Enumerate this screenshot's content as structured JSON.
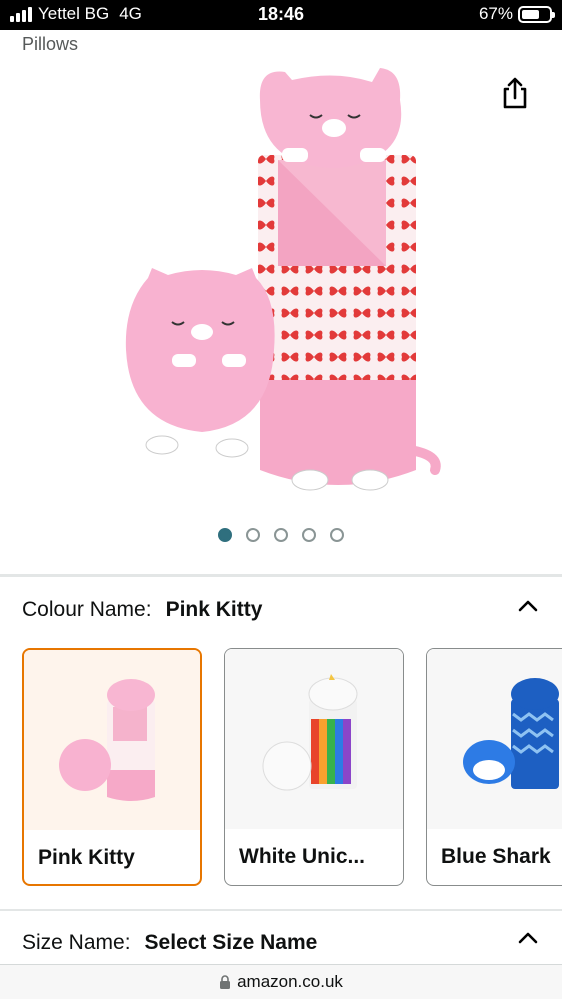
{
  "status_bar": {
    "carrier": "Yettel BG",
    "network": "4G",
    "time": "18:46",
    "battery": "67%",
    "battery_level": 0.67
  },
  "category": "Pillows",
  "carousel": {
    "total": 5,
    "active": 1
  },
  "colour": {
    "label": "Colour Name:",
    "value": "Pink Kitty",
    "options": [
      {
        "name": "Pink Kitty",
        "selected": true
      },
      {
        "name": "White Unic...",
        "selected": false
      },
      {
        "name": "Blue Shark",
        "selected": false
      }
    ]
  },
  "size": {
    "label": "Size Name:",
    "value": "Select Size Name"
  },
  "browser": {
    "domain": "amazon.co.uk"
  },
  "icons": {
    "share": "share-icon",
    "chevron": "chevron-up-icon",
    "lock": "lock-icon"
  },
  "colors": {
    "accent_selected": "#e77600",
    "dot_active": "#2f6f7e"
  }
}
